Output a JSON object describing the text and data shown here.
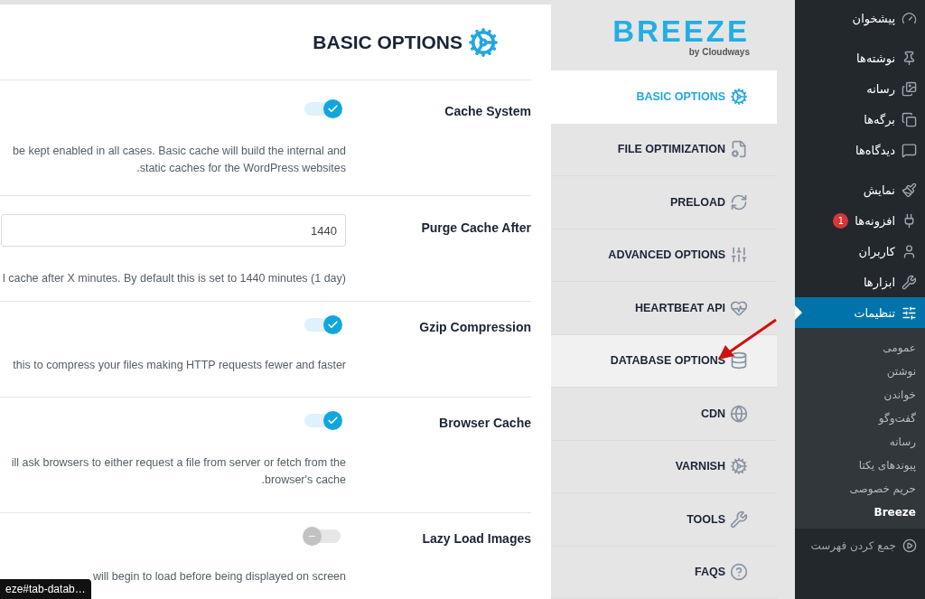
{
  "content": {
    "title": "BASIC OPTIONS",
    "settings": [
      {
        "kind": "toggle",
        "label": "Cache System",
        "on": true,
        "description": "be kept enabled in all cases. Basic cache will build the internal and .static caches for the WordPress websites"
      },
      {
        "kind": "input",
        "label": "Purge Cache After",
        "value": "1440",
        "description": "l cache after X minutes. By default this is set to 1440 minutes (1 day)"
      },
      {
        "kind": "toggle",
        "label": "Gzip Compression",
        "on": true,
        "description": "this to compress your files making HTTP requests fewer and faster"
      },
      {
        "kind": "toggle",
        "label": "Browser Cache",
        "on": true,
        "description": "ill ask browsers to either request a file from server or fetch from the .browser's cache"
      },
      {
        "kind": "toggle",
        "label": "Lazy Load Images",
        "on": false,
        "description": "will begin to load before being displayed on screen"
      }
    ]
  },
  "status_url": "eze#tab-datab…",
  "breeze_nav": {
    "logo": "BREEZE",
    "logo_sub": "by Cloudways",
    "items": [
      {
        "label": "BASIC OPTIONS",
        "selected": true,
        "hovered": false
      },
      {
        "label": "FILE OPTIMIZATION",
        "selected": false,
        "hovered": false
      },
      {
        "label": "PRELOAD",
        "selected": false,
        "hovered": false
      },
      {
        "label": "ADVANCED OPTIONS",
        "selected": false,
        "hovered": false
      },
      {
        "label": "HEARTBEAT API",
        "selected": false,
        "hovered": false
      },
      {
        "label": "DATABASE OPTIONS",
        "selected": false,
        "hovered": true
      },
      {
        "label": "CDN",
        "selected": false,
        "hovered": false
      },
      {
        "label": "VARNISH",
        "selected": false,
        "hovered": false
      },
      {
        "label": "TOOLS",
        "selected": false,
        "hovered": false
      },
      {
        "label": "FAQS",
        "selected": false,
        "hovered": false
      }
    ]
  },
  "admin_menu": {
    "groups": [
      {
        "items": [
          {
            "label": "پیشخوان",
            "selected": false
          }
        ]
      },
      {
        "items": [
          {
            "label": "نوشته‌ها",
            "selected": false
          },
          {
            "label": "رسانه",
            "selected": false
          },
          {
            "label": "برگه‌ها",
            "selected": false
          },
          {
            "label": "دیدگاه‌ها",
            "selected": false
          }
        ]
      },
      {
        "items": [
          {
            "label": "نمایش",
            "selected": false
          },
          {
            "label": "افزونه‌ها",
            "selected": false,
            "badge": "1"
          },
          {
            "label": "کاربران",
            "selected": false
          },
          {
            "label": "ابزارها",
            "selected": false
          },
          {
            "label": "تنظیمات",
            "selected": true
          }
        ]
      }
    ],
    "submenu": [
      {
        "label": "عمومی",
        "selected": false
      },
      {
        "label": "نوشتن",
        "selected": false
      },
      {
        "label": "خواندن",
        "selected": false
      },
      {
        "label": "گفت‌وگو",
        "selected": false
      },
      {
        "label": "رسانه",
        "selected": false
      },
      {
        "label": "پیوندهای یکتا",
        "selected": false
      },
      {
        "label": "حریم خصوصی",
        "selected": false
      },
      {
        "label": "Breeze",
        "selected": true
      }
    ],
    "collapse": "جمع کردن فهرست"
  }
}
